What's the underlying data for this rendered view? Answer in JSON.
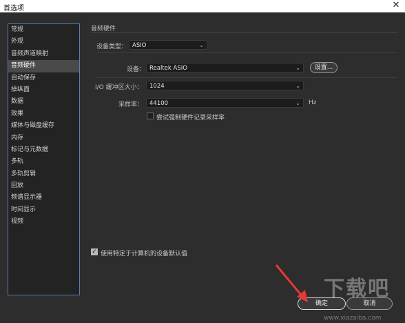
{
  "window": {
    "title": "首选项",
    "close_glyph": "✕"
  },
  "sidebar": {
    "items": [
      {
        "label": "常规"
      },
      {
        "label": "外观"
      },
      {
        "label": "音频声道映射"
      },
      {
        "label": "音频硬件"
      },
      {
        "label": "自动保存"
      },
      {
        "label": "操纵面"
      },
      {
        "label": "数据"
      },
      {
        "label": "效果"
      },
      {
        "label": "媒体与磁盘缓存"
      },
      {
        "label": "内存"
      },
      {
        "label": "标记与元数据"
      },
      {
        "label": "多轨"
      },
      {
        "label": "多轨剪辑"
      },
      {
        "label": "回放"
      },
      {
        "label": "频谱显示器"
      },
      {
        "label": "时间显示"
      },
      {
        "label": "视频"
      }
    ],
    "selected": "音频硬件"
  },
  "main": {
    "section_title": "音频硬件",
    "device_type": {
      "label": "设备类型：",
      "value": "ASIO"
    },
    "device": {
      "label": "设备：",
      "value": "Realtek ASIO",
      "settings_button": "设置..."
    },
    "buffer": {
      "label": "I/O 缓冲区大小：",
      "value": "1024"
    },
    "sample_rate": {
      "label": "采样率：",
      "value": "44100",
      "unit": "Hz"
    },
    "force_rate": {
      "label": "尝试强制硬件记录采样率",
      "checked": false
    },
    "use_defaults": {
      "label": "使用特定于计算机的设备默认值",
      "checked": true
    }
  },
  "footer": {
    "ok_label": "确定",
    "cancel_label": "取消"
  },
  "overlay": {
    "watermark": "下载吧",
    "watermark_sub": "www.xiazaiba.com",
    "arrow_color": "#e53935"
  }
}
